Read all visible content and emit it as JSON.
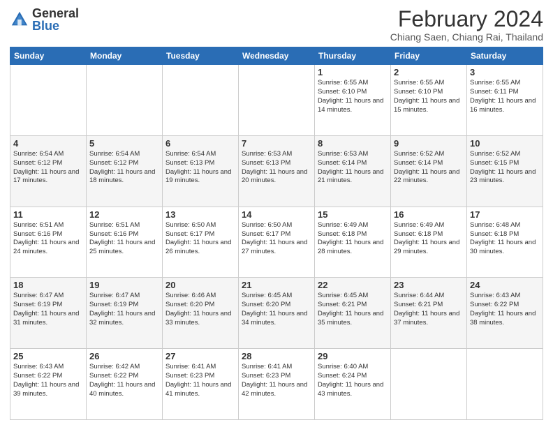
{
  "logo": {
    "general": "General",
    "blue": "Blue"
  },
  "title": "February 2024",
  "subtitle": "Chiang Saen, Chiang Rai, Thailand",
  "days_of_week": [
    "Sunday",
    "Monday",
    "Tuesday",
    "Wednesday",
    "Thursday",
    "Friday",
    "Saturday"
  ],
  "weeks": [
    {
      "alt": false,
      "days": [
        {
          "day": "",
          "sunrise": "",
          "sunset": "",
          "daylight": ""
        },
        {
          "day": "",
          "sunrise": "",
          "sunset": "",
          "daylight": ""
        },
        {
          "day": "",
          "sunrise": "",
          "sunset": "",
          "daylight": ""
        },
        {
          "day": "",
          "sunrise": "",
          "sunset": "",
          "daylight": ""
        },
        {
          "day": "1",
          "sunrise": "Sunrise: 6:55 AM",
          "sunset": "Sunset: 6:10 PM",
          "daylight": "Daylight: 11 hours and 14 minutes."
        },
        {
          "day": "2",
          "sunrise": "Sunrise: 6:55 AM",
          "sunset": "Sunset: 6:10 PM",
          "daylight": "Daylight: 11 hours and 15 minutes."
        },
        {
          "day": "3",
          "sunrise": "Sunrise: 6:55 AM",
          "sunset": "Sunset: 6:11 PM",
          "daylight": "Daylight: 11 hours and 16 minutes."
        }
      ]
    },
    {
      "alt": true,
      "days": [
        {
          "day": "4",
          "sunrise": "Sunrise: 6:54 AM",
          "sunset": "Sunset: 6:12 PM",
          "daylight": "Daylight: 11 hours and 17 minutes."
        },
        {
          "day": "5",
          "sunrise": "Sunrise: 6:54 AM",
          "sunset": "Sunset: 6:12 PM",
          "daylight": "Daylight: 11 hours and 18 minutes."
        },
        {
          "day": "6",
          "sunrise": "Sunrise: 6:54 AM",
          "sunset": "Sunset: 6:13 PM",
          "daylight": "Daylight: 11 hours and 19 minutes."
        },
        {
          "day": "7",
          "sunrise": "Sunrise: 6:53 AM",
          "sunset": "Sunset: 6:13 PM",
          "daylight": "Daylight: 11 hours and 20 minutes."
        },
        {
          "day": "8",
          "sunrise": "Sunrise: 6:53 AM",
          "sunset": "Sunset: 6:14 PM",
          "daylight": "Daylight: 11 hours and 21 minutes."
        },
        {
          "day": "9",
          "sunrise": "Sunrise: 6:52 AM",
          "sunset": "Sunset: 6:14 PM",
          "daylight": "Daylight: 11 hours and 22 minutes."
        },
        {
          "day": "10",
          "sunrise": "Sunrise: 6:52 AM",
          "sunset": "Sunset: 6:15 PM",
          "daylight": "Daylight: 11 hours and 23 minutes."
        }
      ]
    },
    {
      "alt": false,
      "days": [
        {
          "day": "11",
          "sunrise": "Sunrise: 6:51 AM",
          "sunset": "Sunset: 6:16 PM",
          "daylight": "Daylight: 11 hours and 24 minutes."
        },
        {
          "day": "12",
          "sunrise": "Sunrise: 6:51 AM",
          "sunset": "Sunset: 6:16 PM",
          "daylight": "Daylight: 11 hours and 25 minutes."
        },
        {
          "day": "13",
          "sunrise": "Sunrise: 6:50 AM",
          "sunset": "Sunset: 6:17 PM",
          "daylight": "Daylight: 11 hours and 26 minutes."
        },
        {
          "day": "14",
          "sunrise": "Sunrise: 6:50 AM",
          "sunset": "Sunset: 6:17 PM",
          "daylight": "Daylight: 11 hours and 27 minutes."
        },
        {
          "day": "15",
          "sunrise": "Sunrise: 6:49 AM",
          "sunset": "Sunset: 6:18 PM",
          "daylight": "Daylight: 11 hours and 28 minutes."
        },
        {
          "day": "16",
          "sunrise": "Sunrise: 6:49 AM",
          "sunset": "Sunset: 6:18 PM",
          "daylight": "Daylight: 11 hours and 29 minutes."
        },
        {
          "day": "17",
          "sunrise": "Sunrise: 6:48 AM",
          "sunset": "Sunset: 6:18 PM",
          "daylight": "Daylight: 11 hours and 30 minutes."
        }
      ]
    },
    {
      "alt": true,
      "days": [
        {
          "day": "18",
          "sunrise": "Sunrise: 6:47 AM",
          "sunset": "Sunset: 6:19 PM",
          "daylight": "Daylight: 11 hours and 31 minutes."
        },
        {
          "day": "19",
          "sunrise": "Sunrise: 6:47 AM",
          "sunset": "Sunset: 6:19 PM",
          "daylight": "Daylight: 11 hours and 32 minutes."
        },
        {
          "day": "20",
          "sunrise": "Sunrise: 6:46 AM",
          "sunset": "Sunset: 6:20 PM",
          "daylight": "Daylight: 11 hours and 33 minutes."
        },
        {
          "day": "21",
          "sunrise": "Sunrise: 6:45 AM",
          "sunset": "Sunset: 6:20 PM",
          "daylight": "Daylight: 11 hours and 34 minutes."
        },
        {
          "day": "22",
          "sunrise": "Sunrise: 6:45 AM",
          "sunset": "Sunset: 6:21 PM",
          "daylight": "Daylight: 11 hours and 35 minutes."
        },
        {
          "day": "23",
          "sunrise": "Sunrise: 6:44 AM",
          "sunset": "Sunset: 6:21 PM",
          "daylight": "Daylight: 11 hours and 37 minutes."
        },
        {
          "day": "24",
          "sunrise": "Sunrise: 6:43 AM",
          "sunset": "Sunset: 6:22 PM",
          "daylight": "Daylight: 11 hours and 38 minutes."
        }
      ]
    },
    {
      "alt": false,
      "days": [
        {
          "day": "25",
          "sunrise": "Sunrise: 6:43 AM",
          "sunset": "Sunset: 6:22 PM",
          "daylight": "Daylight: 11 hours and 39 minutes."
        },
        {
          "day": "26",
          "sunrise": "Sunrise: 6:42 AM",
          "sunset": "Sunset: 6:22 PM",
          "daylight": "Daylight: 11 hours and 40 minutes."
        },
        {
          "day": "27",
          "sunrise": "Sunrise: 6:41 AM",
          "sunset": "Sunset: 6:23 PM",
          "daylight": "Daylight: 11 hours and 41 minutes."
        },
        {
          "day": "28",
          "sunrise": "Sunrise: 6:41 AM",
          "sunset": "Sunset: 6:23 PM",
          "daylight": "Daylight: 11 hours and 42 minutes."
        },
        {
          "day": "29",
          "sunrise": "Sunrise: 6:40 AM",
          "sunset": "Sunset: 6:24 PM",
          "daylight": "Daylight: 11 hours and 43 minutes."
        },
        {
          "day": "",
          "sunrise": "",
          "sunset": "",
          "daylight": ""
        },
        {
          "day": "",
          "sunrise": "",
          "sunset": "",
          "daylight": ""
        }
      ]
    }
  ]
}
